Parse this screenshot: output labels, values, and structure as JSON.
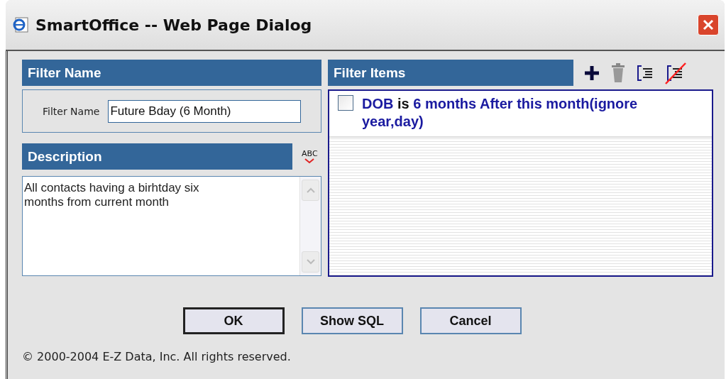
{
  "window": {
    "title": "SmartOffice -- Web Page Dialog"
  },
  "filter_name": {
    "header": "Filter Name",
    "label": "Filter Name",
    "value": "Future Bday (6 Month)"
  },
  "description": {
    "header": "Description",
    "spellcheck_label": "ABC",
    "value": "All contacts having a birhtday six\nmonths from current month"
  },
  "filter_items": {
    "header": "Filter Items",
    "items": [
      {
        "checked": false,
        "field": "DOB",
        "operator": "is",
        "value": "6 months After this month(ignore year,day)"
      }
    ]
  },
  "buttons": [
    {
      "label": "OK",
      "default": true
    },
    {
      "label": "Show SQL",
      "default": false
    },
    {
      "label": "Cancel",
      "default": false
    }
  ],
  "copyright": "© 2000-2004 E-Z Data, Inc. All rights reserved."
}
